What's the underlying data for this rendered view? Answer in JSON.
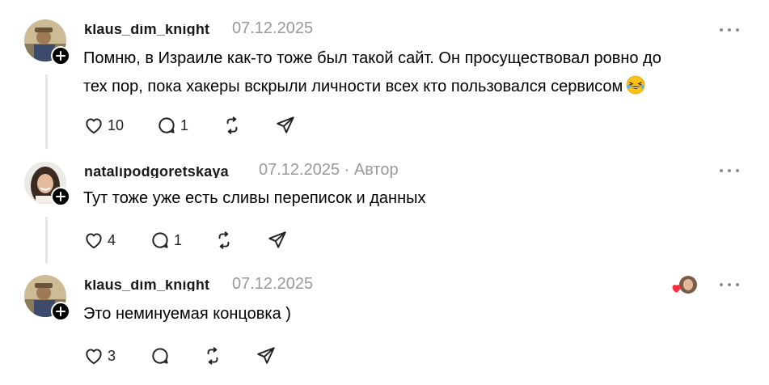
{
  "comments": [
    {
      "username": "klaus_dim_knight",
      "date": "07.12.2025",
      "author_tag": "",
      "text_lines": [
        "Помню, в Израиле как-то тоже был такой сайт. Он просуществовал ровно до",
        "тех пор, пока хакеры вскрыли личности всех кто пользовался сервисом"
      ],
      "emoji": "grinning-squinting-tears-emoji",
      "likes": "10",
      "replies": "1"
    },
    {
      "username": "natalipodgoretskaya",
      "date": "07.12.2025",
      "author_tag": "· Автор",
      "text_lines": [
        "Тут тоже уже есть сливы переписок и данных"
      ],
      "likes": "4",
      "replies": "1"
    },
    {
      "username": "klaus_dim_knight",
      "date": "07.12.2025",
      "author_tag": "",
      "text_lines": [
        "Это неминуемая концовка )"
      ],
      "likes": "3",
      "replies": "",
      "author_liked": true
    }
  ],
  "colors": {
    "text": "#000000",
    "muted": "#999999",
    "thread_line": "#e5e5e5",
    "heart_red": "#ff3040"
  },
  "icons": [
    "heart-icon",
    "comment-icon",
    "repost-icon",
    "share-icon",
    "more-icon",
    "follow-plus-icon"
  ]
}
